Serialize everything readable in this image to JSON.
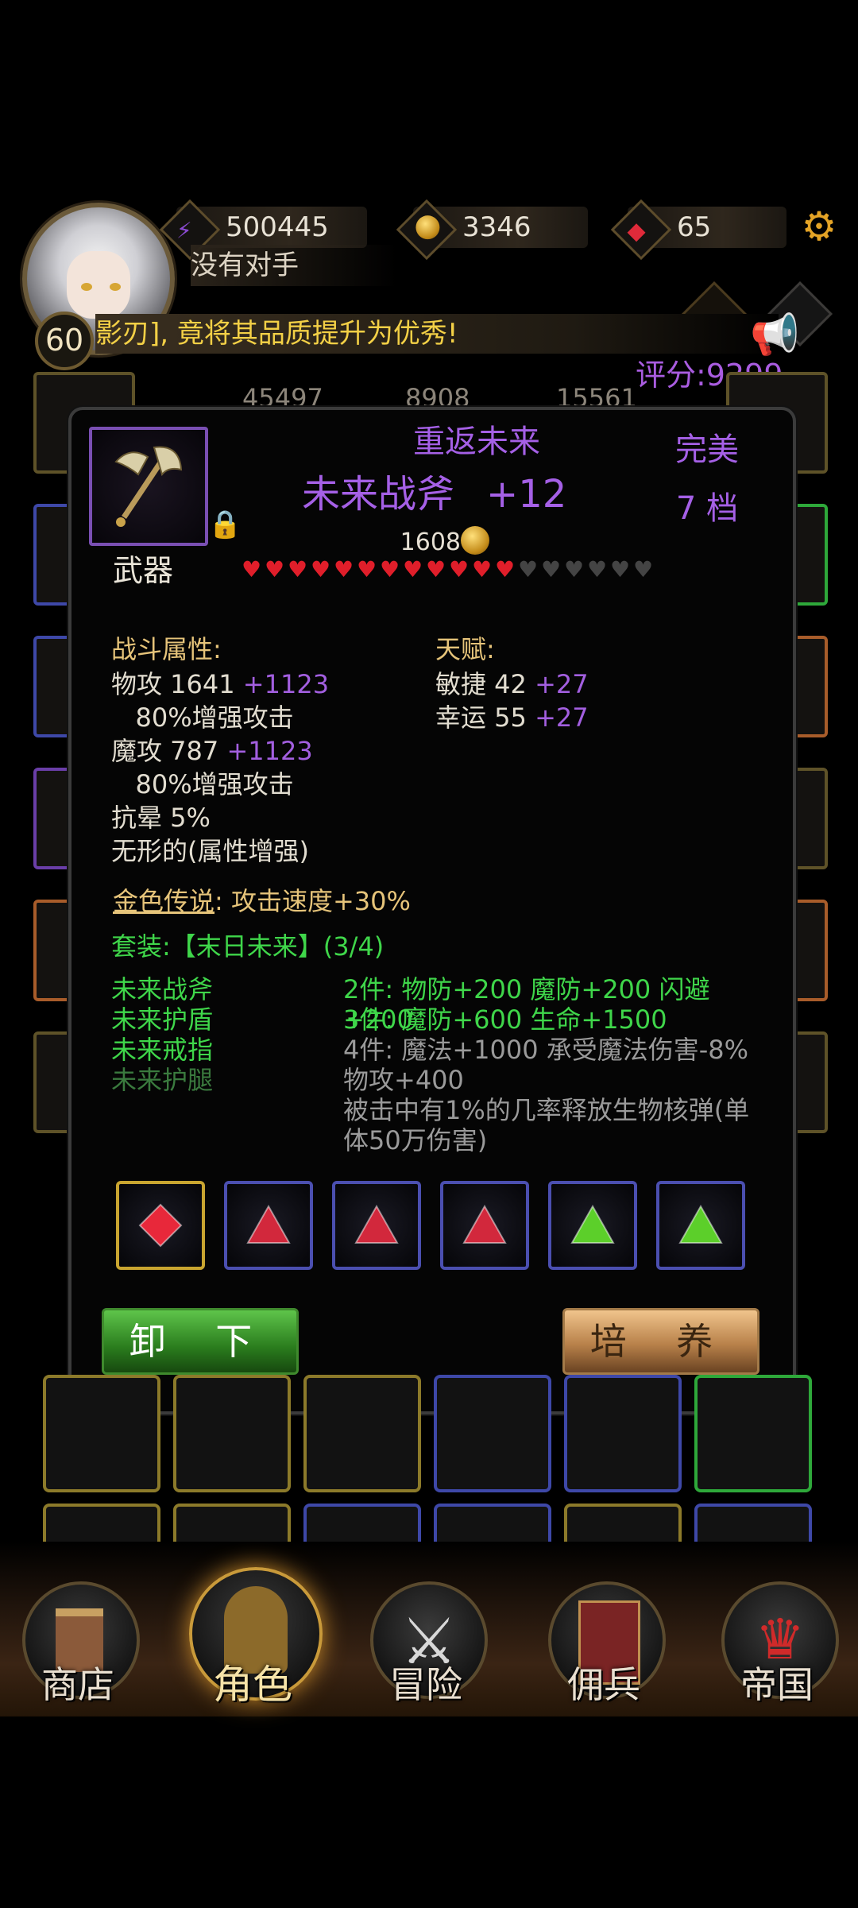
{
  "player": {
    "level": "60",
    "nickname": "没有对手",
    "score": "评分:9299"
  },
  "resources": [
    {
      "name": "power",
      "icon": "power-icon",
      "value": "500445"
    },
    {
      "name": "gold",
      "icon": "gold-coin-icon",
      "value": "3346"
    },
    {
      "name": "gem",
      "icon": "red-gem-icon",
      "value": "65"
    }
  ],
  "ticker": "影刃], 竟将其品质提升为优秀!",
  "background_stats": [
    "45497",
    "8908",
    "15561"
  ],
  "item": {
    "set_name": "重返未来",
    "name": "未来战斧",
    "enhance": "+12",
    "quality": "完美",
    "tier": "7 档",
    "price": "1608",
    "slot": "武器",
    "stars_filled": 12,
    "stars_total": 18
  },
  "combat": {
    "title": "战斗属性:",
    "lines": [
      {
        "label": "物攻 1641",
        "bonus": "+1123"
      },
      {
        "label": "   80%增强攻击",
        "bonus": ""
      },
      {
        "label": "魔攻 787",
        "bonus": "+1123"
      },
      {
        "label": "   80%增强攻击",
        "bonus": ""
      },
      {
        "label": "抗晕 5%",
        "bonus": ""
      },
      {
        "label": "无形的(属性增强)",
        "bonus": ""
      }
    ]
  },
  "talent": {
    "title": "天赋:",
    "lines": [
      {
        "label": "敏捷 42",
        "bonus": "+27"
      },
      {
        "label": "幸运 55",
        "bonus": "+27"
      }
    ]
  },
  "legend": {
    "title": "金色传说",
    "value": ": 攻击速度+30%"
  },
  "set": {
    "title": "套装:【末日未来】(3/4)",
    "pieces": [
      {
        "name": "未来战斧",
        "owned": true
      },
      {
        "name": "未来护盾",
        "owned": true
      },
      {
        "name": "未来戒指",
        "owned": true
      },
      {
        "name": "未来护腿",
        "owned": false
      }
    ],
    "bonuses": [
      {
        "text": "2件: 物防+200 魔防+200 闪避+200",
        "active": true
      },
      {
        "text": "3件: 魔防+600 生命+1500",
        "active": true
      },
      {
        "text": "4件: 魔法+1000 承受魔法伤害-8% 物攻+400",
        "active": false
      },
      {
        "text": "被击中有1%的几率释放生物核弹(单体50万伤害)",
        "active": false
      }
    ]
  },
  "gems": [
    {
      "color": "#e8283a",
      "frame": "#c9a530",
      "shape": "diamond"
    },
    {
      "color": "#d2283c",
      "frame": "#4b4fb0",
      "shape": "triangle"
    },
    {
      "color": "#d2283c",
      "frame": "#4b4fb0",
      "shape": "triangle"
    },
    {
      "color": "#d2283c",
      "frame": "#4b4fb0",
      "shape": "triangle"
    },
    {
      "color": "#5ccf2a",
      "frame": "#4b4fb0",
      "shape": "triangle"
    },
    {
      "color": "#5ccf2a",
      "frame": "#4b4fb0",
      "shape": "triangle"
    }
  ],
  "buttons": {
    "unequip": "卸 下",
    "train": "培 养"
  },
  "nav": [
    {
      "label": "商店",
      "icon": "shop-castle-icon",
      "active": false
    },
    {
      "label": "角色",
      "icon": "character-hood-icon",
      "active": true
    },
    {
      "label": "冒险",
      "icon": "crossed-swords-icon",
      "active": false
    },
    {
      "label": "佣兵",
      "icon": "mercenary-card-icon",
      "active": false
    },
    {
      "label": "帝国",
      "icon": "crown-icon",
      "active": false
    }
  ],
  "colors": {
    "purple": "#a560e6",
    "gold": "#e6c47a",
    "green": "#3fd64a"
  }
}
